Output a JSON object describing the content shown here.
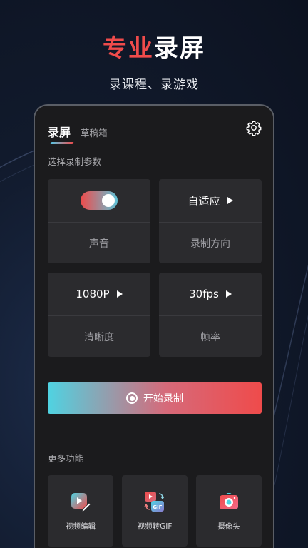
{
  "hero": {
    "title_accent": "专业",
    "title_rest": "录屏",
    "subtitle": "录课程、录游戏"
  },
  "tabs": {
    "active": "录屏",
    "inactive": "草稿箱"
  },
  "settings_icon": "gear-icon",
  "params_label": "选择录制参数",
  "params": {
    "sound": {
      "label": "声音",
      "toggle_on": true
    },
    "orientation": {
      "value": "自适应",
      "label": "录制方向"
    },
    "resolution": {
      "value": "1080P",
      "label": "清晰度"
    },
    "framerate": {
      "value": "30fps",
      "label": "帧率"
    }
  },
  "record_button": {
    "label": "开始录制",
    "icon": "record-icon"
  },
  "more_label": "更多功能",
  "tools": [
    {
      "label": "视频编辑",
      "icon": "video-edit-icon"
    },
    {
      "label": "视频转GIF",
      "icon": "video-to-gif-icon"
    },
    {
      "label": "摄像头",
      "icon": "camera-icon"
    }
  ],
  "colors": {
    "accent_red": "#ef4b4b",
    "accent_cyan": "#4fd3e2",
    "card_bg": "#2b2b2e",
    "panel_bg": "#1b1b1d"
  }
}
